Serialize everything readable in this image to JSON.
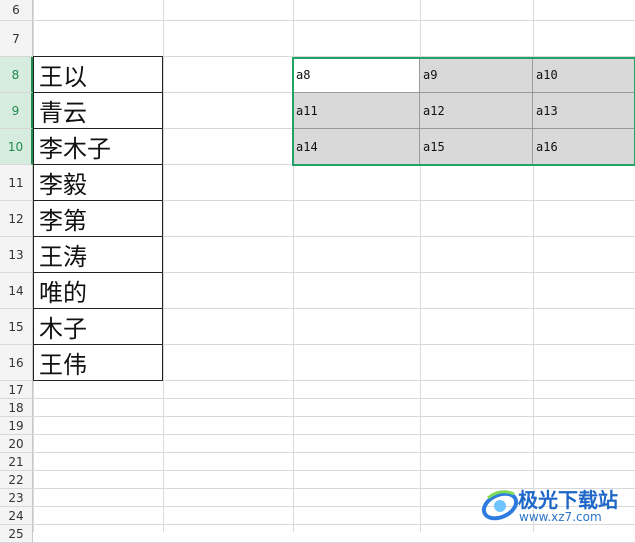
{
  "spreadsheet": {
    "row_numbers": [
      "6",
      "7",
      "8",
      "9",
      "10",
      "11",
      "12",
      "13",
      "14",
      "15",
      "16",
      "17",
      "18",
      "19",
      "20",
      "21",
      "22",
      "23",
      "24",
      "25"
    ],
    "selected_rows": [
      "8",
      "9",
      "10"
    ],
    "names": [
      "王以",
      "青云",
      "李木子",
      "李毅",
      "李第",
      "王涛",
      "唯的",
      "木子",
      "王伟"
    ],
    "grid": [
      [
        "a8",
        "a9",
        "a10"
      ],
      [
        "a11",
        "a12",
        "a13"
      ],
      [
        "a14",
        "a15",
        "a16"
      ]
    ],
    "active_cell": "a8"
  },
  "watermark": {
    "title": "极光下载站",
    "url": "www.xz7.com"
  },
  "colors": {
    "selection_border": "#21a366",
    "selected_header_bg": "#d6ecdf",
    "range_fill": "#d9d9d9"
  }
}
